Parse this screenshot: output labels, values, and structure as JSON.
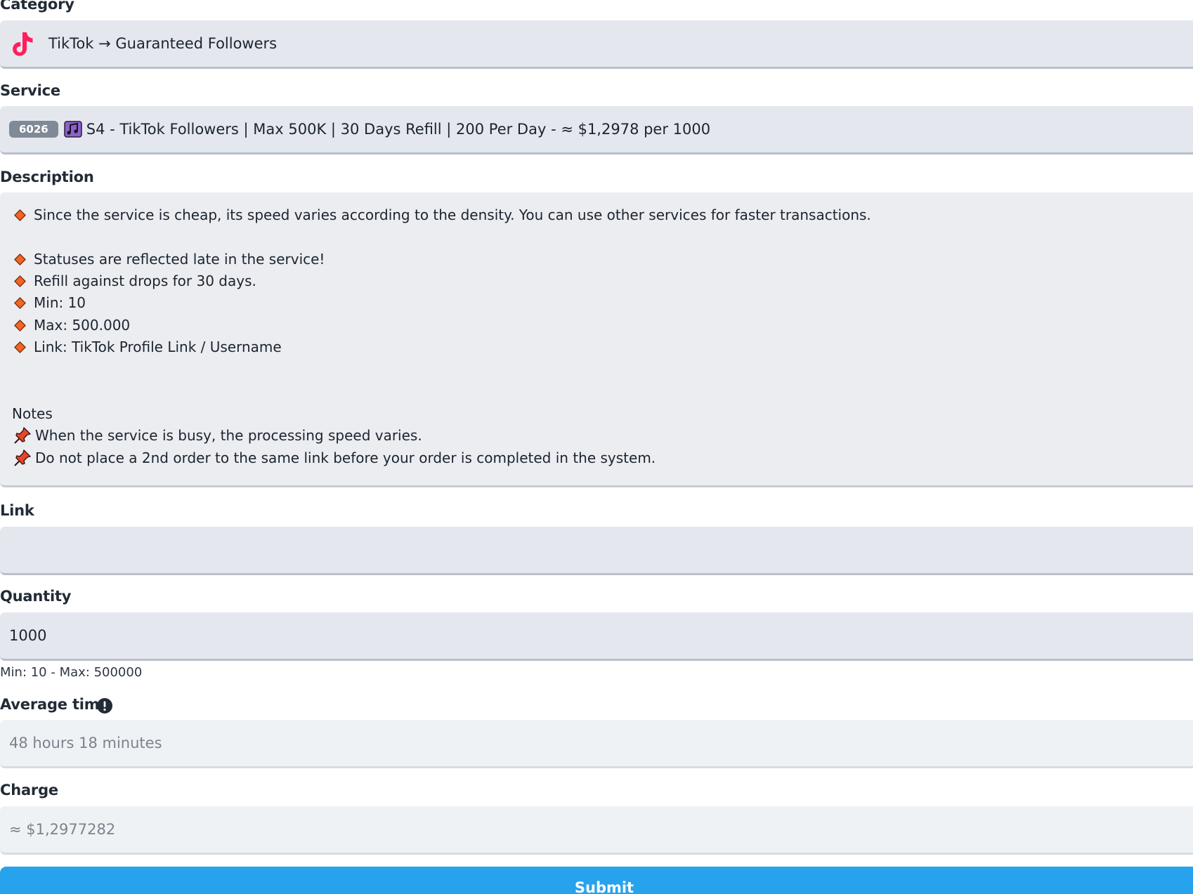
{
  "category": {
    "label": "Category",
    "icon": "tiktok-icon",
    "value": "TikTok → Guaranteed Followers"
  },
  "service": {
    "label": "Service",
    "id": "6026",
    "icon": "music-note-icon",
    "value": "S4 - TikTok Followers | Max 500K | 30 Days Refill | 200 Per Day - ≈ $1,2978 per 1000"
  },
  "description": {
    "label": "Description",
    "lines": [
      "Since the service is cheap, its speed varies according to the density. You can use other services for faster transactions.",
      "Statuses are reflected late in the service!",
      "Refill against drops for 30 days.",
      "Min: 10",
      "Max: 500.000",
      "Link: TikTok Profile Link / Username"
    ],
    "notes_title": "Notes",
    "notes": [
      "When the service is busy, the processing speed varies.",
      "Do not place a 2nd order to the same link before your order is completed in the system."
    ],
    "bullet_color": "#f26522",
    "pin_color": "#e8452c"
  },
  "link": {
    "label": "Link",
    "value": ""
  },
  "quantity": {
    "label": "Quantity",
    "value": "1000",
    "hint": "Min: 10 - Max: 500000"
  },
  "average_time": {
    "label": "Average time",
    "value": "48 hours 18 minutes"
  },
  "charge": {
    "label": "Charge",
    "value": "≈ $1,2977282"
  },
  "submit": {
    "label": "Submit",
    "color": "#27a3ee"
  }
}
